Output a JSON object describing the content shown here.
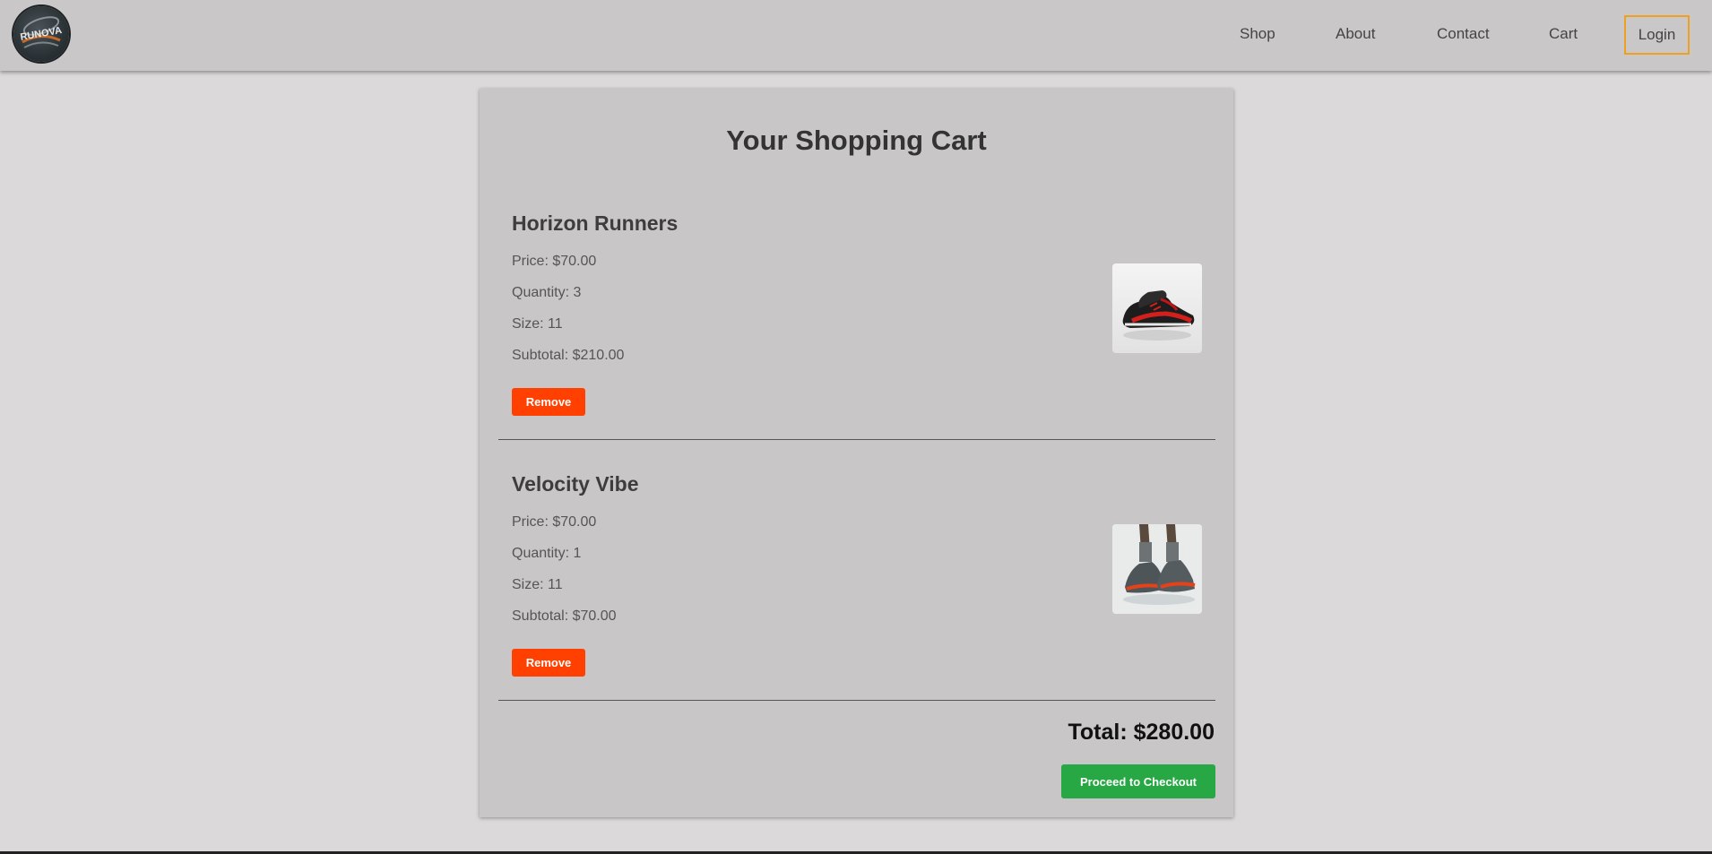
{
  "header": {
    "logo_text": "RUNOVA",
    "nav": {
      "shop": "Shop",
      "about": "About",
      "contact": "Contact",
      "cart": "Cart",
      "login": "Login"
    }
  },
  "cart": {
    "title": "Your Shopping Cart",
    "items": [
      {
        "name": "Horizon Runners",
        "price": "Price: $70.00",
        "quantity": "Quantity: 3",
        "size": "Size: 11",
        "subtotal": "Subtotal: $210.00",
        "remove_label": "Remove",
        "image_icon": "sneaker-red-black-icon"
      },
      {
        "name": "Velocity Vibe",
        "price": "Price: $70.00",
        "quantity": "Quantity: 1",
        "size": "Size: 11",
        "subtotal": "Subtotal: $70.00",
        "remove_label": "Remove",
        "image_icon": "sneaker-on-feet-icon"
      }
    ],
    "total": "Total: $280.00",
    "checkout_label": "Proceed to Checkout"
  },
  "colors": {
    "accent_login_border": "#f0a020",
    "remove_button": "#ff4000",
    "checkout_button": "#27a844",
    "header_bg": "#c9c7c8",
    "page_bg": "#dbd9da"
  }
}
